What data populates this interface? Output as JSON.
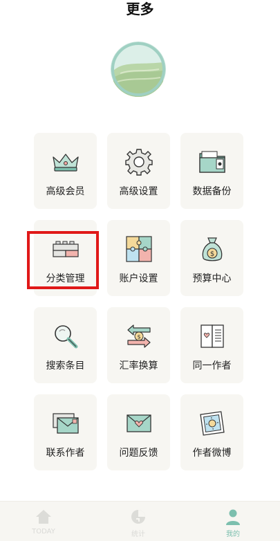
{
  "header": {
    "title": "更多"
  },
  "grid": {
    "items": [
      {
        "label": "高级会员",
        "icon": "crown-icon"
      },
      {
        "label": "高级设置",
        "icon": "gear-icon"
      },
      {
        "label": "数据备份",
        "icon": "folder-icon"
      },
      {
        "label": "分类管理",
        "icon": "blocks-icon"
      },
      {
        "label": "账户设置",
        "icon": "puzzle-icon"
      },
      {
        "label": "预算中心",
        "icon": "money-bag-icon"
      },
      {
        "label": "搜索条目",
        "icon": "magnifier-icon"
      },
      {
        "label": "汇率换算",
        "icon": "exchange-icon"
      },
      {
        "label": "同一作者",
        "icon": "book-icon"
      },
      {
        "label": "联系作者",
        "icon": "envelopes-icon"
      },
      {
        "label": "问题反馈",
        "icon": "heart-letter-icon"
      },
      {
        "label": "作者微博",
        "icon": "sun-photo-icon"
      }
    ]
  },
  "highlight": {
    "target": "分类管理",
    "color": "#e01818"
  },
  "tabbar": {
    "tabs": [
      {
        "label": "TODAY",
        "icon": "home-icon",
        "active": false
      },
      {
        "label": "统计",
        "icon": "pie-chart-icon",
        "active": false
      },
      {
        "label": "我的",
        "icon": "person-icon",
        "active": true
      }
    ],
    "active_color": "#7cbfae",
    "inactive_color": "#d9d9d6"
  }
}
